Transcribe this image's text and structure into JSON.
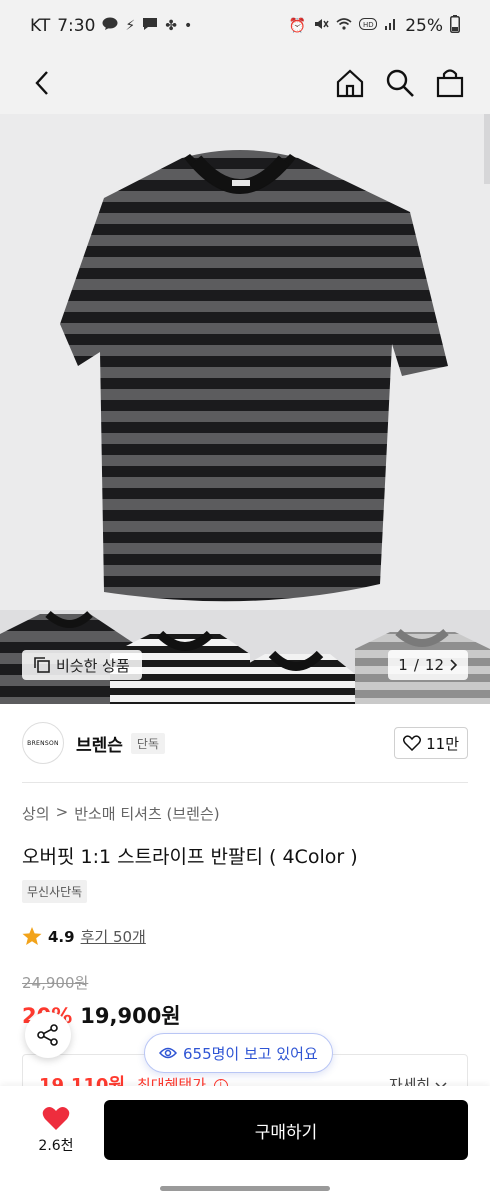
{
  "status_bar": {
    "carrier": "KT",
    "time": "7:30",
    "battery": "25%"
  },
  "hero": {
    "similar_label": "비슷한 상품",
    "page_current": "1",
    "page_total": "12",
    "page_separator": "/"
  },
  "brand": {
    "logo_text": "BRENSON",
    "name": "브렌슨",
    "badge": "단독",
    "like_count": "11만"
  },
  "product": {
    "breadcrumb": [
      "상의",
      "반소매 티셔츠 (브렌슨)"
    ],
    "title": "오버핏 1:1 스트라이프 반팔티 ( 4Color )",
    "exclusive_tag": "무신사단독",
    "rating": "4.9",
    "review_text": "후기 50개",
    "original_price": "24,900원",
    "discount": "20%",
    "sale_price": "19,900원"
  },
  "benefit": {
    "price": "19,110원",
    "label": "최대혜택가",
    "detail": "자세히"
  },
  "overlay": {
    "viewers": "655명이 보고 있어요"
  },
  "bottom": {
    "wish_count": "2.6천",
    "buy_label": "구매하기"
  },
  "colors": {
    "accent_red": "#ff3a2f",
    "viewer_blue": "#2f55d4",
    "buy_button": "#000000"
  }
}
